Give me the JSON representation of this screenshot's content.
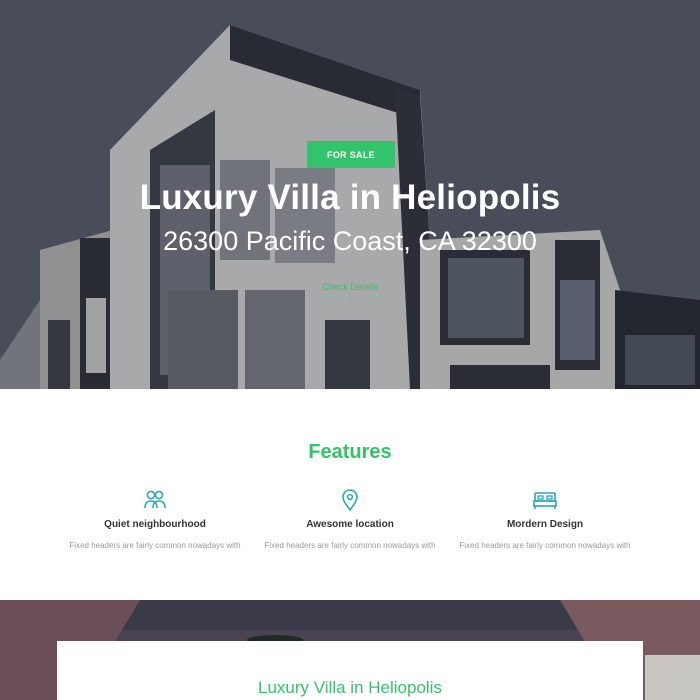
{
  "colors": {
    "accent": "#33c46b",
    "title_text": "#333333",
    "muted_text": "#9a9a9a"
  },
  "hero": {
    "badge": "FOR SALE",
    "title": "Luxury Villa in Heliopolis",
    "address": "26300 Pacific Coast, CA 32300",
    "link_label": "Check Details",
    "link_arrow": "↓"
  },
  "features": {
    "heading": "Features",
    "items": [
      {
        "icon": "users-icon",
        "title": "Quiet neighbourhood",
        "description": "Fixed headers are fairly common nowadays with"
      },
      {
        "icon": "location-pin-icon",
        "title": "Awesome location",
        "description": "Fixed headers are fairly common nowadays with"
      },
      {
        "icon": "bed-icon",
        "title": "Mordern Design",
        "description": "Fixed headers are fairly common nowadays with"
      }
    ]
  },
  "listing_card": {
    "title": "Luxury Villa in Heliopolis"
  }
}
